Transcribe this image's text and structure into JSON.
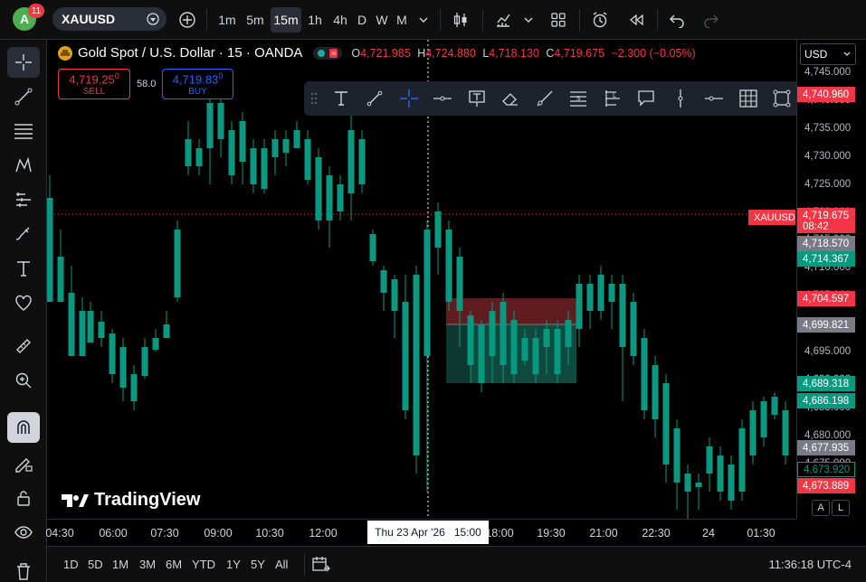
{
  "topbar": {
    "avatar_letter": "A",
    "notifications": "11",
    "symbol": "XAUUSD",
    "intervals": [
      "1m",
      "5m",
      "15m",
      "1h",
      "4h",
      "D",
      "W",
      "M"
    ],
    "active_interval": "15m"
  },
  "legend": {
    "title": "Gold Spot / U.S. Dollar · 15 · OANDA",
    "o_label": "O",
    "o_value": "4,721.985",
    "h_label": "H",
    "h_value": "4,724.880",
    "l_label": "L",
    "l_value": "4,718.130",
    "c_label": "C",
    "c_value": "4,719.675",
    "change": "−2.300 (−0.05%)"
  },
  "trade": {
    "sell_price": "4,719.25",
    "sell_sup": "0",
    "sell_label": "SELL",
    "spread": "58.0",
    "buy_price": "4,719.83",
    "buy_sup": "0",
    "buy_label": "BUY"
  },
  "pricescale": {
    "currency": "USD",
    "labels": [
      "4,745.000",
      "4,740.000",
      "4,735.000",
      "4,730.000",
      "4,725.000",
      "4,720.000",
      "4,715.000",
      "4,710.000",
      "4,705.000",
      "4,700.000",
      "4,695.000",
      "4,690.000",
      "4,685.000",
      "4,680.000",
      "4,675.000"
    ],
    "badges": [
      {
        "text": "4,740.960",
        "color": "#f23645"
      },
      {
        "text": "XAUUSD",
        "color": "#f23645"
      },
      {
        "text": "4,719.675",
        "color": "#f23645"
      },
      {
        "text": "08:42",
        "color": "#f23645"
      },
      {
        "text": "4,718.570",
        "color": "#787b86"
      },
      {
        "text": "4,714.367",
        "color": "#089981"
      },
      {
        "text": "4,704.597",
        "color": "#f23645"
      },
      {
        "text": "4,699.821",
        "color": "#787b86"
      },
      {
        "text": "4,689.318",
        "color": "#089981"
      },
      {
        "text": "4,686.198",
        "color": "#089981"
      },
      {
        "text": "4,677.935",
        "color": "#787b86"
      },
      {
        "text": "4,673.920",
        "color": "#000000"
      },
      {
        "text": "4,673.889",
        "color": "#f23645"
      }
    ],
    "auto_label": "A",
    "log_label": "L"
  },
  "timescale": {
    "labels": [
      "04:30",
      "06:00",
      "07:30",
      "09:00",
      "10:30",
      "12:00",
      "15:00",
      "18:00",
      "19:30",
      "21:00",
      "22:30",
      "24",
      "01:30"
    ],
    "crosshair_label": "Thu 23 Apr '26   15:00"
  },
  "bottombar": {
    "ranges": [
      "1D",
      "5D",
      "1M",
      "3M",
      "6M",
      "YTD",
      "1Y",
      "5Y",
      "All"
    ],
    "clock": "11:36:18 UTC-4"
  },
  "watermark": "TradingView",
  "colors": {
    "up": "#089981",
    "down": "#f23645",
    "bg": "#000000"
  }
}
